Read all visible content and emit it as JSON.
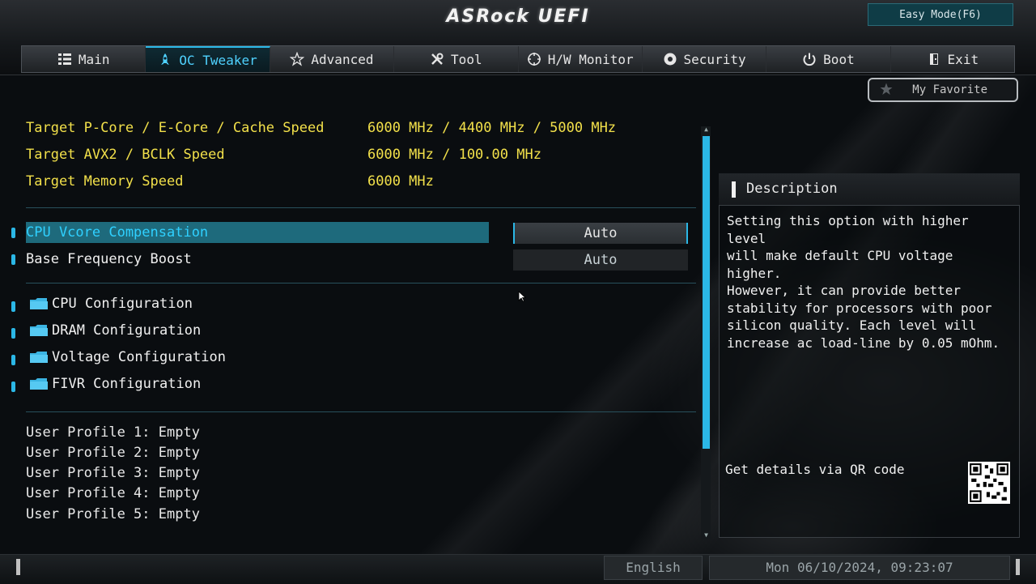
{
  "header": {
    "logo": "ASRock UEFI",
    "easy_mode": "Easy Mode(F6)"
  },
  "tabs": [
    {
      "label": "Main",
      "icon": "list-icon"
    },
    {
      "label": "OC Tweaker",
      "icon": "rocket-icon",
      "active": true
    },
    {
      "label": "Advanced",
      "icon": "star-outline-icon"
    },
    {
      "label": "Tool",
      "icon": "tools-icon"
    },
    {
      "label": "H/W Monitor",
      "icon": "crosshair-icon"
    },
    {
      "label": "Security",
      "icon": "shield-icon"
    },
    {
      "label": "Boot",
      "icon": "power-icon"
    },
    {
      "label": "Exit",
      "icon": "exit-door-icon"
    }
  ],
  "favorite": {
    "label": "My Favorite",
    "icon": "star-icon"
  },
  "info": [
    {
      "label": "Target P-Core / E-Core / Cache Speed",
      "value": "6000 MHz / 4400 MHz / 5000 MHz"
    },
    {
      "label": "Target AVX2 / BCLK Speed",
      "value": "6000 MHz / 100.00 MHz"
    },
    {
      "label": "Target Memory Speed",
      "value": "6000 MHz"
    }
  ],
  "settings": [
    {
      "label": "CPU Vcore Compensation",
      "value": "Auto",
      "selected": true
    },
    {
      "label": "Base Frequency Boost",
      "value": "Auto"
    }
  ],
  "folders": [
    "CPU Configuration",
    "DRAM Configuration",
    "Voltage Configuration",
    "FIVR Configuration"
  ],
  "profiles": [
    "User Profile 1: Empty",
    "User Profile 2: Empty",
    "User Profile 3: Empty",
    "User Profile 4: Empty",
    "User Profile 5: Empty"
  ],
  "description": {
    "title": "Description",
    "text": "Setting this option with higher level\nwill make default CPU voltage higher.\nHowever, it can provide better\nstability for processors with poor\nsilicon quality. Each level will\nincrease ac load-line by 0.05 mOhm.",
    "qr_label": "Get details via QR code"
  },
  "footer": {
    "language": "English",
    "datetime": "Mon 06/10/2024, 09:23:07"
  },
  "colors": {
    "accent": "#2bb7e6",
    "info_text": "#f2e04a",
    "selected_bg": "#1e6a7c"
  }
}
